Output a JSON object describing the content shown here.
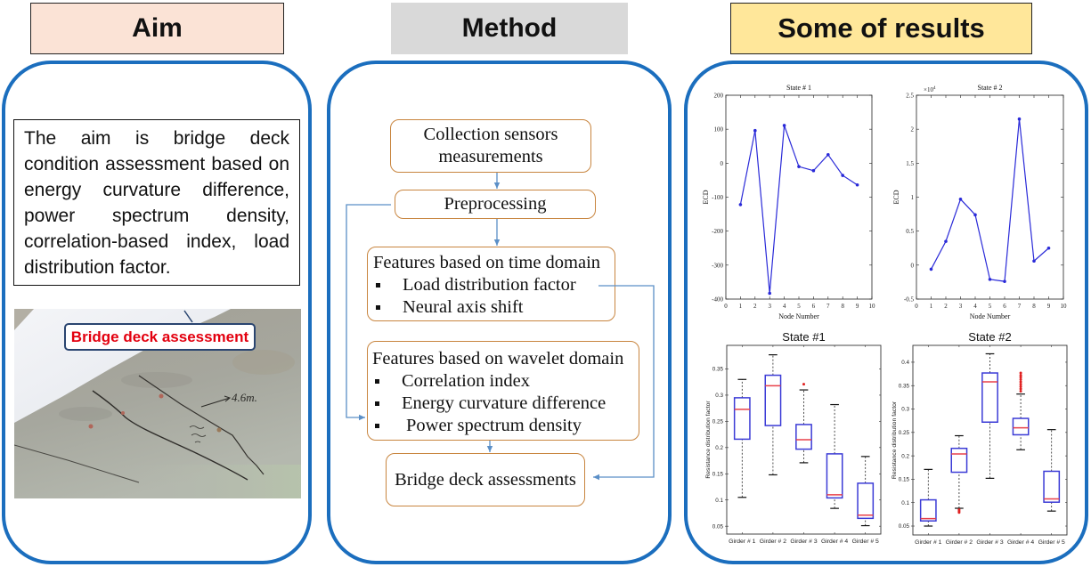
{
  "sections": {
    "aim": {
      "title": "Aim",
      "text": "The aim is bridge deck condition assessment based on energy curvature difference, power spectrum density, correlation-based index, load distribution factor.",
      "photo_label": "Bridge deck assessment",
      "photo_annotation": "4.6m."
    },
    "method": {
      "title": "Method",
      "steps": {
        "collection": {
          "label": "Collection sensors measurements"
        },
        "preprocessing": {
          "label": "Preprocessing"
        },
        "time_domain": {
          "heading": "Features based on time domain",
          "items": [
            "Load distribution factor",
            "Neural axis shift"
          ]
        },
        "wavelet_domain": {
          "heading": "Features based on wavelet domain",
          "items": [
            "Correlation index",
            "Energy curvature difference",
            "Power spectrum density"
          ]
        },
        "assessment": {
          "label": "Bridge deck assessments"
        }
      }
    },
    "results": {
      "title": "Some of results"
    }
  },
  "colors": {
    "panel_border": "#1b6ebe",
    "aim_header_bg": "#FBE3D6",
    "method_header_bg": "#D9D9D9",
    "results_header_bg": "#FFE79A",
    "flow_border": "#c8853f",
    "connector": "#5b8fc7",
    "photo_label_text": "#e3000f",
    "line_series": "#2a2ad8",
    "box_outline": "#3b3bd6",
    "box_median": "#e8404a",
    "box_outlier": "#e02020"
  },
  "chart_data": [
    {
      "type": "line",
      "title": "State # 1",
      "xlabel": "Node Number",
      "ylabel": "ECD",
      "x": [
        1,
        2,
        3,
        4,
        5,
        6,
        7,
        8,
        9
      ],
      "values": [
        -122,
        96,
        -383,
        111,
        -10,
        -22,
        25,
        -36,
        -64
      ],
      "xlim": [
        0,
        10
      ],
      "ylim": [
        -400,
        200
      ],
      "xticks": [
        0,
        1,
        2,
        3,
        4,
        5,
        6,
        7,
        8,
        9,
        10
      ],
      "yticks": [
        -400,
        -300,
        -200,
        -100,
        0,
        100,
        200
      ],
      "grid": false
    },
    {
      "type": "line",
      "title": "State # 2",
      "xlabel": "Node Number",
      "ylabel": "ECD",
      "y_multiplier": {
        "base": "×10",
        "exponent": "4"
      },
      "x": [
        1,
        2,
        3,
        4,
        5,
        6,
        7,
        8,
        9
      ],
      "values": [
        -0.06,
        0.35,
        0.97,
        0.74,
        -0.21,
        -0.24,
        2.15,
        0.06,
        0.25
      ],
      "xlim": [
        0,
        10
      ],
      "ylim": [
        -0.5,
        2.5
      ],
      "xticks": [
        0,
        1,
        2,
        3,
        4,
        5,
        6,
        7,
        8,
        9,
        10
      ],
      "yticks": [
        -0.5,
        0,
        0.5,
        1,
        1.5,
        2,
        2.5
      ],
      "grid": false
    },
    {
      "type": "box",
      "title": "State #1",
      "xlabel": "",
      "ylabel": "Resistance distribution factor",
      "categories": [
        "Girder # 1",
        "Girder # 2",
        "Girder # 3",
        "Girder # 4",
        "Girder # 5"
      ],
      "boxes": [
        {
          "whisker_low": 0.105,
          "q1": 0.216,
          "median": 0.273,
          "q3": 0.295,
          "whisker_high": 0.33,
          "outliers": []
        },
        {
          "whisker_low": 0.148,
          "q1": 0.242,
          "median": 0.318,
          "q3": 0.338,
          "whisker_high": 0.377,
          "outliers": []
        },
        {
          "whisker_low": 0.171,
          "q1": 0.197,
          "median": 0.215,
          "q3": 0.244,
          "whisker_high": 0.31,
          "outliers": [
            0.321
          ]
        },
        {
          "whisker_low": 0.084,
          "q1": 0.104,
          "median": 0.11,
          "q3": 0.188,
          "whisker_high": 0.282,
          "outliers": []
        },
        {
          "whisker_low": 0.051,
          "q1": 0.065,
          "median": 0.071,
          "q3": 0.132,
          "whisker_high": 0.183,
          "outliers": []
        }
      ],
      "ylim": [
        0.035,
        0.395
      ],
      "yticks": [
        0.05,
        0.1,
        0.15,
        0.2,
        0.25,
        0.3,
        0.35
      ],
      "grid": false
    },
    {
      "type": "box",
      "title": "State #2",
      "xlabel": "",
      "ylabel": "Resistance distribution factor",
      "categories": [
        "Girder # 1",
        "Girder # 2",
        "Girder # 3",
        "Girder # 4",
        "Girder # 5"
      ],
      "boxes": [
        {
          "whisker_low": 0.05,
          "q1": 0.061,
          "median": 0.066,
          "q3": 0.106,
          "whisker_high": 0.171,
          "outliers": []
        },
        {
          "whisker_low": 0.088,
          "q1": 0.165,
          "median": 0.204,
          "q3": 0.216,
          "whisker_high": 0.243,
          "outliers": [
            0.079,
            0.082,
            0.085
          ]
        },
        {
          "whisker_low": 0.152,
          "q1": 0.272,
          "median": 0.358,
          "q3": 0.377,
          "whisker_high": 0.418,
          "outliers": []
        },
        {
          "whisker_low": 0.213,
          "q1": 0.245,
          "median": 0.26,
          "q3": 0.28,
          "whisker_high": 0.332,
          "outliers": [
            0.338,
            0.343,
            0.348,
            0.353,
            0.358,
            0.363,
            0.368,
            0.372,
            0.377
          ]
        },
        {
          "whisker_low": 0.082,
          "q1": 0.101,
          "median": 0.108,
          "q3": 0.167,
          "whisker_high": 0.256,
          "outliers": []
        }
      ],
      "ylim": [
        0.031,
        0.436
      ],
      "yticks": [
        0.05,
        0.1,
        0.15,
        0.2,
        0.25,
        0.3,
        0.35,
        0.4
      ],
      "grid": false
    }
  ]
}
